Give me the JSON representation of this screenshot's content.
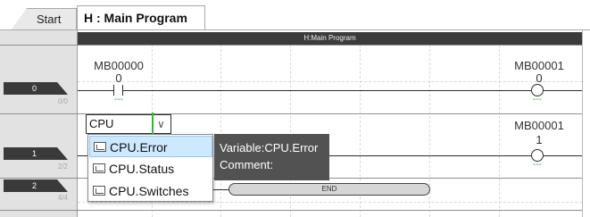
{
  "tabs": [
    {
      "label": "Start"
    },
    {
      "label": "H : Main Program"
    }
  ],
  "editor": {
    "header_title": "H:Main Program",
    "rungs": [
      {
        "step": "0",
        "count": "0/0",
        "contact_label": "MB00000",
        "contact_value": "0",
        "contact_comment": "---",
        "coil_label": "MB00001",
        "coil_value": "0",
        "coil_comment": "---"
      },
      {
        "step": "1",
        "count": "2/2",
        "input_value": "CPU",
        "coil_label": "MB00001",
        "coil_value": "1",
        "coil_comment": "---"
      },
      {
        "step": "2",
        "count": "4/4",
        "end_label": "END"
      }
    ]
  },
  "autocomplete": {
    "items": [
      {
        "label": "CPU.Error",
        "icon": "variable-icon",
        "selected": true
      },
      {
        "label": "CPU.Status",
        "icon": "variable-icon",
        "selected": false
      },
      {
        "label": "CPU.Switches",
        "icon": "variable-icon",
        "selected": false
      }
    ],
    "tooltip_variable": "Variable:CPU.Error",
    "tooltip_comment": "Comment:"
  },
  "colors": {
    "header_bg": "#3b3b3b",
    "selected_bg": "#cde8ff",
    "tooltip_bg": "#525252",
    "green_marker": "#3ab03a"
  }
}
